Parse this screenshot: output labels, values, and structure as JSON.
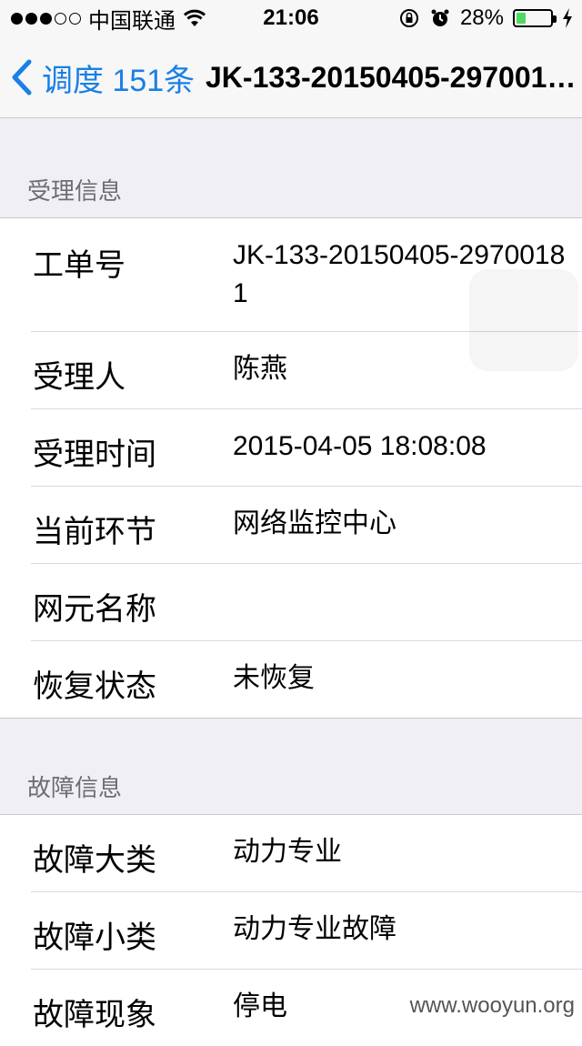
{
  "status_bar": {
    "carrier": "中国联通",
    "time": "21:06",
    "battery_percent": "28%",
    "signal_strength_bars": 3,
    "signal_total": 5,
    "battery_level": 0.28,
    "battery_color": "#4cd964"
  },
  "nav": {
    "back_label": "调度 151条",
    "title": "JK-133-20150405-297001…",
    "accent_color": "#1a7fe6"
  },
  "sections": [
    {
      "header": "受理信息",
      "rows": [
        {
          "label": "工单号",
          "value": "JK-133-20150405-29700181"
        },
        {
          "label": "受理人",
          "value": "陈燕"
        },
        {
          "label": "受理时间",
          "value": "2015-04-05 18:08:08"
        },
        {
          "label": "当前环节",
          "value": "网络监控中心"
        },
        {
          "label": "网元名称",
          "value": ""
        },
        {
          "label": "恢复状态",
          "value": "未恢复"
        }
      ]
    },
    {
      "header": "故障信息",
      "rows": [
        {
          "label": "故障大类",
          "value": "动力专业"
        },
        {
          "label": "故障小类",
          "value": "动力专业故障"
        },
        {
          "label": "故障现象",
          "value": "停电"
        }
      ]
    }
  ],
  "watermark": "www.wooyun.org"
}
